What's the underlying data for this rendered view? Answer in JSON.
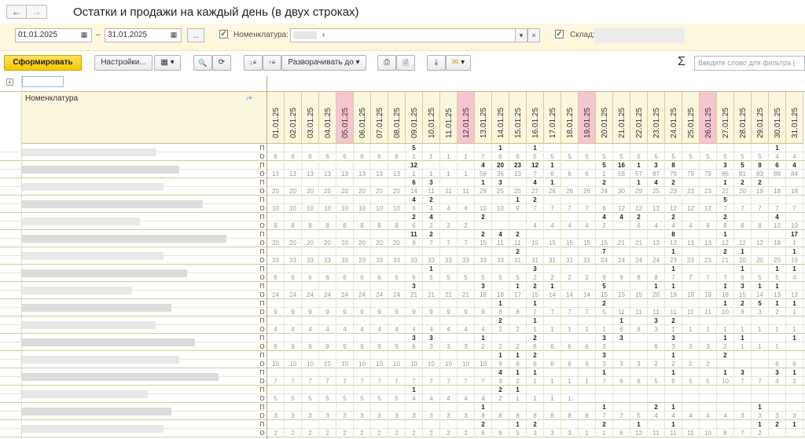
{
  "window": {
    "title": "Остатки и продажи на каждый день (в двух строках)"
  },
  "nav": {
    "back": "←",
    "forward": "→"
  },
  "params": {
    "date_from": "01.01.2025",
    "dash": "–",
    "date_to": "31.01.2025",
    "ellipsis": "...",
    "nomenclature_label": "Номенклатура:",
    "nomenclature_value": "‹",
    "warehouse_label": "Склад:",
    "check": "✓",
    "clear": "×",
    "dropdown": "▾",
    "cal": "▦"
  },
  "toolbar": {
    "generate": "Сформировать",
    "settings": "Настройки...",
    "expand": "Разворачивать до",
    "sigma": "Σ",
    "search_placeholder": "Введите слово для фильтра (",
    "caret": "▾",
    "icon_variants": "▦",
    "icon_find": "🔍",
    "icon_findnext": "⟳",
    "icon_sort1": "↓≡",
    "icon_sort2": "↑≡",
    "icon_print": "⎙",
    "icon_preview": "🗎",
    "icon_save": "⤓",
    "icon_mail": "✉"
  },
  "report": {
    "expander": "+",
    "column_header": "Номенклатура",
    "sort_icon": "↓≡",
    "dates": [
      "01.01.25",
      "02.01.25",
      "03.01.25",
      "04.01.25",
      "05.01.25",
      "06.01.25",
      "07.01.25",
      "08.01.25",
      "09.01.25",
      "10.01.25",
      "11.01.25",
      "12.01.25",
      "13.01.25",
      "14.01.25",
      "15.01.25",
      "16.01.25",
      "17.01.25",
      "18.01.25",
      "19.01.25",
      "20.01.25",
      "21.01.25",
      "22.01.25",
      "23.01.25",
      "24.01.25",
      "25.01.25",
      "26.01.25",
      "27.01.25",
      "28.01.25",
      "29.01.25",
      "30.01.25",
      "31.01.25"
    ],
    "weekend_columns": [
      4,
      11,
      18,
      25
    ],
    "rows": [
      {
        "type": "П",
        "values": [
          "",
          "",
          "",
          "",
          "",
          "",
          "",
          "",
          "5",
          "",
          "",
          "",
          "",
          "1",
          "",
          "1",
          "",
          "",
          "",
          "",
          "",
          "",
          "",
          "",
          "",
          "",
          "",
          "",
          "",
          "1",
          ""
        ]
      },
      {
        "type": "О",
        "values": [
          "6",
          "6",
          "6",
          "6",
          "6",
          "6",
          "6",
          "6",
          "1",
          "1",
          "1",
          "1",
          "7",
          "6",
          "6",
          "5",
          "5",
          "5",
          "5",
          "5",
          "5",
          "5",
          "5",
          "5",
          "5",
          "5",
          "5",
          "5",
          "5",
          "4",
          "4"
        ]
      },
      {
        "type": "П",
        "values": [
          "",
          "",
          "",
          "",
          "",
          "",
          "",
          "",
          "12",
          "",
          "",
          "",
          "4",
          "20",
          "23",
          "12",
          "1",
          "",
          "",
          "5",
          "16",
          "1",
          "3",
          "8",
          "",
          "",
          "3",
          "5",
          "8",
          "6",
          "4"
        ]
      },
      {
        "type": "О",
        "values": [
          "13",
          "13",
          "13",
          "13",
          "13",
          "13",
          "13",
          "13",
          "1",
          "1",
          "1",
          "1",
          "56",
          "36",
          "13",
          "7",
          "6",
          "6",
          "6",
          "1",
          "58",
          "57",
          "87",
          "79",
          "79",
          "79",
          "86",
          "81",
          "83",
          "88",
          "84"
        ]
      },
      {
        "type": "П",
        "values": [
          "",
          "",
          "",
          "",
          "",
          "",
          "",
          "",
          "6",
          "3",
          "",
          "",
          "1",
          "3",
          "",
          "4",
          "1",
          "",
          "",
          "2",
          "",
          "1",
          "4",
          "2",
          "",
          "",
          "1",
          "2",
          "2",
          "",
          ""
        ]
      },
      {
        "type": "О",
        "values": [
          "20",
          "20",
          "20",
          "20",
          "20",
          "20",
          "20",
          "20",
          "14",
          "11",
          "11",
          "11",
          "28",
          "25",
          "25",
          "27",
          "26",
          "26",
          "26",
          "24",
          "30",
          "29",
          "25",
          "23",
          "23",
          "23",
          "22",
          "20",
          "18",
          "18",
          "18"
        ]
      },
      {
        "type": "П",
        "values": [
          "",
          "",
          "",
          "",
          "",
          "",
          "",
          "",
          "4",
          "2",
          "",
          "",
          "",
          "",
          "1",
          "2",
          "",
          "",
          "",
          "",
          "",
          "",
          "",
          "",
          "",
          "",
          "5",
          "",
          "",
          "",
          ""
        ]
      },
      {
        "type": "О",
        "values": [
          "10",
          "10",
          "10",
          "10",
          "10",
          "10",
          "10",
          "10",
          "6",
          "4",
          "4",
          "4",
          "10",
          "10",
          "9",
          "7",
          "7",
          "7",
          "7",
          "6",
          "12",
          "12",
          "12",
          "12",
          "12",
          "12",
          "7",
          "7",
          "7",
          "7",
          "7"
        ]
      },
      {
        "type": "П",
        "values": [
          "",
          "",
          "",
          "",
          "",
          "",
          "",
          "",
          "2",
          "4",
          "",
          "",
          "2",
          "",
          "",
          "",
          "",
          "",
          "",
          "4",
          "4",
          "2",
          "",
          "2",
          "",
          "",
          "2",
          "",
          "",
          "4",
          ""
        ]
      },
      {
        "type": "О",
        "values": [
          "8",
          "8",
          "8",
          "8",
          "8",
          "8",
          "8",
          "8",
          "6",
          "2",
          "2",
          "2",
          "",
          "",
          "",
          "4",
          "4",
          "4",
          "4",
          "2",
          "",
          "6",
          "4",
          "4",
          "4",
          "8",
          "8",
          "8",
          "8",
          "10",
          "10"
        ]
      },
      {
        "type": "П",
        "values": [
          "",
          "",
          "",
          "",
          "",
          "",
          "",
          "",
          "11",
          "2",
          "",
          "",
          "2",
          "4",
          "2",
          "",
          "",
          "",
          "",
          "",
          "",
          "",
          "",
          "8",
          "",
          "",
          "1",
          "",
          "",
          "",
          "17"
        ]
      },
      {
        "type": "О",
        "values": [
          "20",
          "20",
          "20",
          "20",
          "20",
          "20",
          "20",
          "20",
          "9",
          "7",
          "7",
          "7",
          "15",
          "11",
          "11",
          "15",
          "15",
          "15",
          "15",
          "15",
          "21",
          "21",
          "13",
          "13",
          "13",
          "13",
          "12",
          "12",
          "12",
          "18",
          "1"
        ]
      },
      {
        "type": "П",
        "values": [
          "",
          "",
          "",
          "",
          "",
          "",
          "",
          "",
          "",
          "",
          "",
          "",
          "",
          "",
          "2",
          "",
          "",
          "",
          "",
          "7",
          "",
          "",
          "",
          "1",
          "",
          "",
          "2",
          "1",
          "",
          "",
          "1"
        ]
      },
      {
        "type": "О",
        "values": [
          "33",
          "33",
          "33",
          "33",
          "33",
          "33",
          "33",
          "33",
          "33",
          "33",
          "33",
          "33",
          "33",
          "33",
          "31",
          "31",
          "31",
          "31",
          "31",
          "24",
          "24",
          "24",
          "24",
          "23",
          "23",
          "23",
          "21",
          "20",
          "20",
          "20",
          "19"
        ]
      },
      {
        "type": "П",
        "values": [
          "",
          "",
          "",
          "",
          "",
          "",
          "",
          "",
          "",
          "1",
          "",
          "",
          "",
          "",
          "",
          "3",
          "",
          "",
          "",
          "",
          "",
          "",
          "",
          "1",
          "",
          "",
          "",
          "1",
          "",
          "1",
          "1"
        ]
      },
      {
        "type": "О",
        "values": [
          "6",
          "6",
          "6",
          "6",
          "6",
          "6",
          "6",
          "6",
          "6",
          "5",
          "5",
          "5",
          "5",
          "5",
          "5",
          "2",
          "2",
          "2",
          "2",
          "9",
          "9",
          "8",
          "8",
          "7",
          "7",
          "7",
          "7",
          "6",
          "5",
          "5",
          "4"
        ]
      },
      {
        "type": "П",
        "values": [
          "",
          "",
          "",
          "",
          "",
          "",
          "",
          "",
          "3",
          "",
          "",
          "",
          "3",
          "",
          "1",
          "2",
          "1",
          "",
          "",
          "5",
          "",
          "",
          "1",
          "1",
          "",
          "",
          "1",
          "3",
          "1",
          "1",
          ""
        ]
      },
      {
        "type": "О",
        "values": [
          "24",
          "24",
          "24",
          "24",
          "24",
          "24",
          "24",
          "24",
          "21",
          "21",
          "21",
          "21",
          "18",
          "18",
          "17",
          "15",
          "14",
          "14",
          "14",
          "15",
          "15",
          "15",
          "20",
          "19",
          "19",
          "19",
          "18",
          "15",
          "14",
          "13",
          "13"
        ]
      },
      {
        "type": "П",
        "values": [
          "",
          "",
          "",
          "",
          "",
          "",
          "",
          "",
          "",
          "",
          "",
          "",
          "",
          "1",
          "",
          "1",
          "",
          "",
          "",
          "2",
          "",
          "",
          "",
          "",
          "",
          "",
          "1",
          "2",
          "5",
          "1",
          "1"
        ]
      },
      {
        "type": "О",
        "values": [
          "9",
          "9",
          "9",
          "9",
          "9",
          "9",
          "9",
          "9",
          "9",
          "9",
          "9",
          "9",
          "9",
          "8",
          "8",
          "7",
          "7",
          "7",
          "7",
          "5",
          "11",
          "11",
          "11",
          "11",
          "11",
          "11",
          "10",
          "8",
          "3",
          "2",
          "1"
        ]
      },
      {
        "type": "П",
        "values": [
          "",
          "",
          "",
          "",
          "",
          "",
          "",
          "",
          "",
          "",
          "",
          "",
          "",
          "2",
          "",
          "1",
          "",
          "",
          "",
          "",
          "1",
          "",
          "3",
          "2",
          "",
          "",
          "",
          "",
          "",
          "",
          ""
        ]
      },
      {
        "type": "О",
        "values": [
          "4",
          "4",
          "4",
          "4",
          "4",
          "4",
          "4",
          "4",
          "4",
          "4",
          "4",
          "4",
          "4",
          "2",
          "2",
          "1",
          "1",
          "1",
          "1",
          "1",
          "6",
          "6",
          "3",
          "1",
          "1",
          "1",
          "1",
          "1",
          "1",
          "1",
          "1"
        ]
      },
      {
        "type": "П",
        "values": [
          "",
          "",
          "",
          "",
          "",
          "",
          "",
          "",
          "3",
          "3",
          "",
          "",
          "1",
          "",
          "",
          "2",
          "",
          "",
          "",
          "3",
          "3",
          "",
          "",
          "3",
          "",
          "",
          "1",
          "1",
          "",
          "",
          "1"
        ]
      },
      {
        "type": "О",
        "values": [
          "9",
          "9",
          "9",
          "9",
          "9",
          "9",
          "9",
          "9",
          "6",
          "3",
          "3",
          "3",
          "2",
          "2",
          "2",
          "6",
          "6",
          "6",
          "6",
          "3",
          "",
          "",
          "6",
          "3",
          "3",
          "3",
          "2",
          "1",
          "1",
          "1",
          ""
        ]
      },
      {
        "type": "П",
        "values": [
          "",
          "",
          "",
          "",
          "",
          "",
          "",
          "",
          "",
          "",
          "",
          "",
          "",
          "1",
          "1",
          "2",
          "",
          "",
          "",
          "3",
          "",
          "",
          "",
          "1",
          "",
          "",
          "2",
          "",
          "",
          "",
          ""
        ]
      },
      {
        "type": "О",
        "values": [
          "10",
          "10",
          "10",
          "10",
          "10",
          "10",
          "10",
          "10",
          "10",
          "10",
          "10",
          "10",
          "10",
          "9",
          "8",
          "6",
          "6",
          "6",
          "6",
          "3",
          "3",
          "3",
          "2",
          "2",
          "2",
          "2",
          "",
          "",
          "",
          "6",
          "6"
        ]
      },
      {
        "type": "П",
        "values": [
          "",
          "",
          "",
          "",
          "",
          "",
          "",
          "",
          "",
          "",
          "",
          "",
          "",
          "4",
          "1",
          "1",
          "",
          "",
          "",
          "1",
          "",
          "",
          "",
          "1",
          "",
          "",
          "1",
          "3",
          "",
          "3",
          "1"
        ]
      },
      {
        "type": "О",
        "values": [
          "7",
          "7",
          "7",
          "7",
          "7",
          "7",
          "7",
          "7",
          "7",
          "7",
          "7",
          "7",
          "7",
          "3",
          "2",
          "1",
          "1",
          "1",
          "1",
          "7",
          "6",
          "6",
          "5",
          "5",
          "5",
          "5",
          "10",
          "7",
          "7",
          "4",
          "3"
        ]
      },
      {
        "type": "П",
        "values": [
          "",
          "",
          "",
          "",
          "",
          "",
          "",
          "",
          "1",
          "",
          "",
          "",
          "",
          "2",
          "1",
          "",
          "",
          "",
          "",
          "",
          "",
          "",
          "",
          "",
          "",
          "",
          "",
          "",
          "",
          "",
          ""
        ]
      },
      {
        "type": "О",
        "values": [
          "5",
          "5",
          "5",
          "5",
          "5",
          "5",
          "5",
          "5",
          "4",
          "4",
          "4",
          "4",
          "4",
          "2",
          "1",
          "1",
          "1",
          "1",
          "",
          "",
          "",
          "",
          "",
          "",
          "",
          "",
          "",
          "",
          "",
          "",
          ""
        ]
      },
      {
        "type": "П",
        "values": [
          "",
          "",
          "",
          "",
          "",
          "",
          "",
          "",
          "",
          "",
          "",
          "",
          "1",
          "",
          "",
          "",
          "",
          "",
          "",
          "1",
          "",
          "",
          "2",
          "1",
          "",
          "",
          "",
          "",
          "1",
          "",
          ""
        ]
      },
      {
        "type": "О",
        "values": [
          "3",
          "3",
          "3",
          "3",
          "3",
          "3",
          "3",
          "3",
          "3",
          "3",
          "3",
          "3",
          "8",
          "8",
          "8",
          "8",
          "8",
          "8",
          "8",
          "7",
          "7",
          "5",
          "4",
          "4",
          "4",
          "4",
          "4",
          "3",
          "3",
          "3",
          "3"
        ]
      },
      {
        "type": "П",
        "values": [
          "",
          "",
          "",
          "",
          "",
          "",
          "",
          "",
          "",
          "",
          "",
          "",
          "2",
          "",
          "1",
          "2",
          "",
          "",
          "",
          "2",
          "",
          "1",
          "",
          "1",
          "",
          "",
          "",
          "",
          "1",
          "2",
          "1"
        ]
      },
      {
        "type": "О",
        "values": [
          "2",
          "2",
          "2",
          "2",
          "2",
          "2",
          "2",
          "2",
          "2",
          "2",
          "2",
          "2",
          "6",
          "6",
          "5",
          "3",
          "3",
          "3",
          "1",
          "1",
          "6",
          "12",
          "11",
          "11",
          "11",
          "10",
          "8",
          "7",
          "2",
          "",
          ""
        ]
      }
    ]
  }
}
